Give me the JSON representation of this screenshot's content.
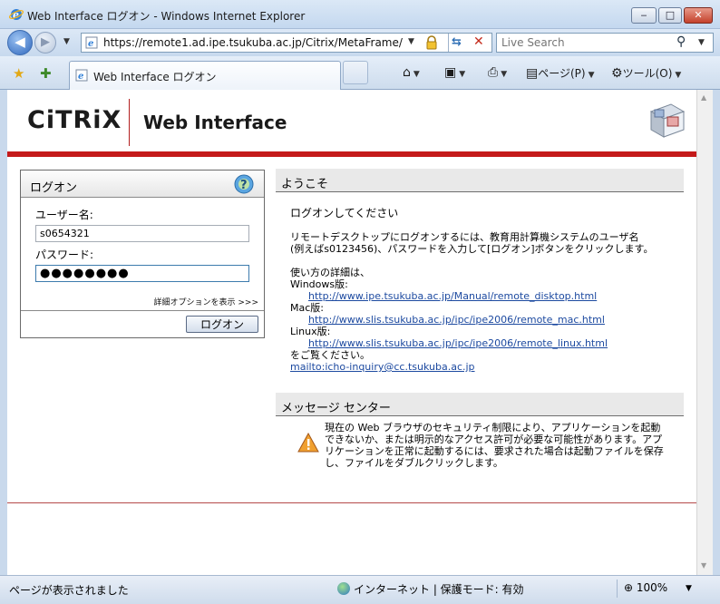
{
  "window": {
    "title": "Web Interface ログオン - Windows Internet Explorer",
    "min_symbol": "‒",
    "max_symbol": "□",
    "close_symbol": "✕"
  },
  "address": {
    "url": "https://remote1.ad.ipe.tsukuba.ac.jp/Citrix/MetaFrame/",
    "search_placeholder": "Live Search"
  },
  "tabs": [
    {
      "label": "Web Interface ログオン"
    }
  ],
  "toolbar": {
    "page_label": "ページ(P)",
    "tools_label": "ツール(O)"
  },
  "header": {
    "logo_text": "CiTRiX",
    "title": "Web Interface"
  },
  "logon": {
    "panel_title": "ログオン",
    "username_label": "ユーザー名:",
    "username_value": "s0654321",
    "password_label": "パスワード:",
    "password_masked": "●●●●●●●●",
    "advanced_link": "詳細オプションを表示 >>>",
    "logon_button": "ログオン"
  },
  "welcome": {
    "section_title": "ようこそ",
    "line1": "ログオンしてください",
    "line2": "リモートデスクトップにログオンするには、教育用計算機システムのユーザ名",
    "line3": "(例えばs0123456)、パスワードを入力して[ログオン]ボタンをクリックします。",
    "usage_intro": "使い方の詳細は、",
    "windows_label": "Windows版:",
    "windows_url": "http://www.ipe.tsukuba.ac.jp/Manual/remote_disktop.html",
    "mac_label": "Mac版:",
    "mac_url": "http://www.slis.tsukuba.ac.jp/ipc/ipe2006/remote_mac.html",
    "linux_label": "Linux版:",
    "linux_url": "http://www.slis.tsukuba.ac.jp/ipc/ipe2006/remote_linux.html",
    "see_text": "をご覧ください。",
    "mail_link": "mailto:icho-inquiry@cc.tsukuba.ac.jp"
  },
  "message_center": {
    "section_title": "メッセージ センター",
    "text": "現在の Web ブラウザのセキュリティ制限により、アプリケーションを起動できないか、または明示的なアクセス許可が必要な可能性があります。アプリケーションを正常に起動するには、要求された場合は起動ファイルを保存し、ファイルをダブルクリックします。"
  },
  "status": {
    "left": "ページが表示されました",
    "zone": "インターネット | 保護モード: 有効",
    "zoom": "100%"
  },
  "colors": {
    "accent_red": "#c41a1a",
    "link_blue": "#1d4aa0"
  }
}
